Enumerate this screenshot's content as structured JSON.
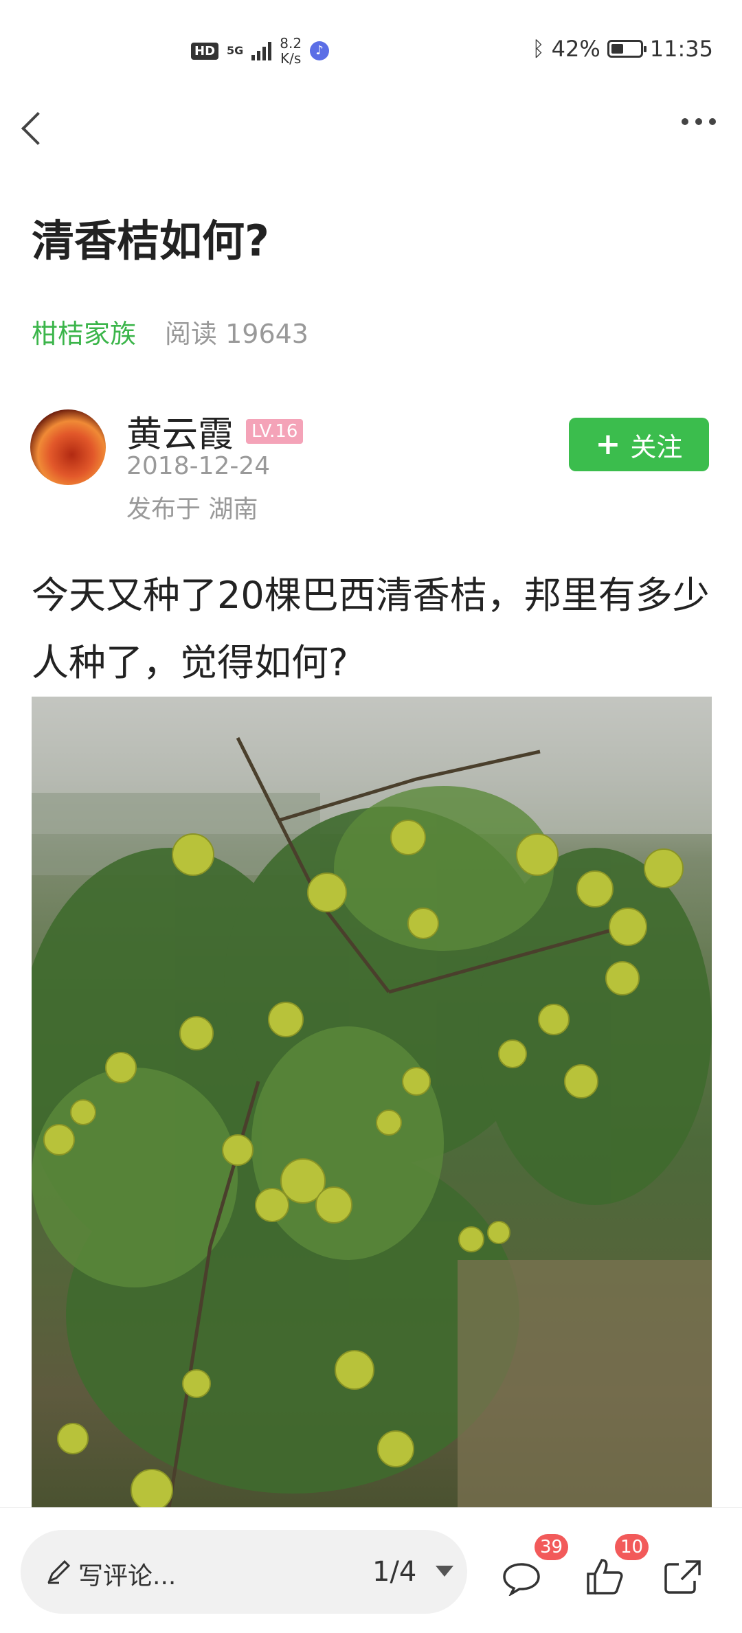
{
  "status_bar": {
    "hd": "HD",
    "network": "5G",
    "speed_value": "8.2",
    "speed_unit": "K/s",
    "battery_percent": "42%",
    "battery_level": 0.42,
    "time": "11:35"
  },
  "post": {
    "title": "清香桔如何?",
    "group": "柑桔家族",
    "reads": "阅读 19643",
    "author": {
      "name": "黄云霞",
      "level": "LV.16",
      "date": "2018-12-24",
      "location": "发布于 湖南"
    },
    "follow_label": "关注",
    "content": "今天又种了20棵巴西清香桔，邦里有多少人种了，觉得如何?"
  },
  "bottom_bar": {
    "comment_placeholder": "写评论...",
    "page_indicator": "1/4",
    "comment_count": "39",
    "like_count": "10"
  },
  "colors": {
    "accent_green": "#3bbd4d",
    "group_link": "#3bb54a",
    "level_badge": "#f4a3b8",
    "count_badge": "#f25a5a"
  }
}
